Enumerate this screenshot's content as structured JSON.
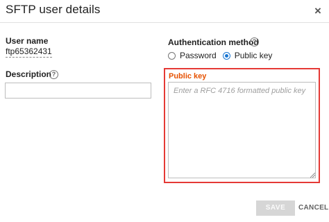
{
  "dialog": {
    "title": "SFTP user details",
    "close_icon": "close-icon",
    "close_glyph": "×"
  },
  "user": {
    "label": "User name",
    "value": "ftp65362431"
  },
  "description": {
    "label": "Description",
    "help_icon": "help-circle-icon",
    "help_glyph": "?",
    "value": "",
    "placeholder": ""
  },
  "auth": {
    "label": "Authentication method",
    "help_icon": "help-circle-icon",
    "help_glyph": "?",
    "options": [
      {
        "label": "Password",
        "selected": false
      },
      {
        "label": "Public key",
        "selected": true
      }
    ]
  },
  "public_key": {
    "label": "Public key",
    "placeholder": "Enter a RFC 4716 formatted public key",
    "value": ""
  },
  "actions": {
    "save_label": "SAVE",
    "cancel_label": "CANCEL"
  },
  "colors": {
    "accent": "#1976d2",
    "highlight_border": "#e53935",
    "public_key_label": "#e65100",
    "disabled_button": "#d6d6d6"
  }
}
